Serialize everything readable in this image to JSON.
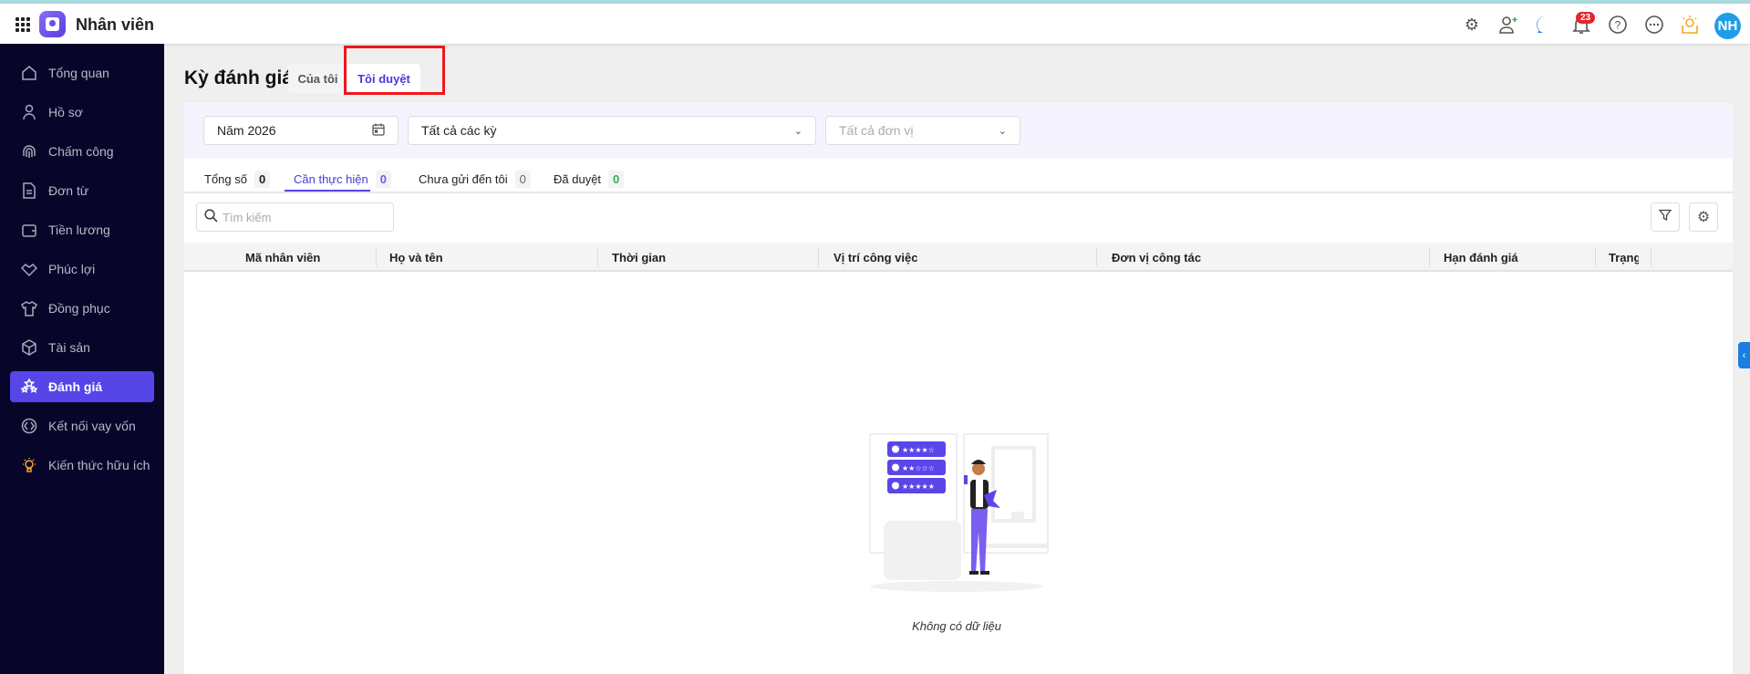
{
  "app": {
    "title": "Nhân viên",
    "notification_count": "23",
    "avatar_initials": "NH"
  },
  "topbar_icons": [
    "settings-icon",
    "add-user-icon",
    "chat-icon",
    "bell-icon",
    "help-icon",
    "more-icon",
    "knowledge-icon"
  ],
  "sidebar": {
    "items": [
      {
        "label": "Tổng quan",
        "icon": "home-icon"
      },
      {
        "label": "Hồ sơ",
        "icon": "user-icon"
      },
      {
        "label": "Chấm công",
        "icon": "fingerprint-icon"
      },
      {
        "label": "Đơn từ",
        "icon": "document-icon"
      },
      {
        "label": "Tiền lương",
        "icon": "wallet-icon"
      },
      {
        "label": "Phúc lợi",
        "icon": "handshake-icon"
      },
      {
        "label": "Đồng phục",
        "icon": "shirt-icon"
      },
      {
        "label": "Tài sản",
        "icon": "box-icon"
      },
      {
        "label": "Đánh giá",
        "icon": "stars-icon",
        "active": true
      },
      {
        "label": "Kết nối vay vốn",
        "icon": "link-icon"
      },
      {
        "label": "Kiến thức hữu ích",
        "icon": "bulb-icon"
      }
    ]
  },
  "page": {
    "title": "Kỳ đánh giá",
    "tabs": [
      {
        "label": "Của tôi"
      },
      {
        "label": "Tôi duyệt",
        "active": true
      }
    ]
  },
  "filters": {
    "year": "Năm 2026",
    "period": "Tất cả các kỳ",
    "unit_placeholder": "Tất cả đơn vị"
  },
  "status_tabs": [
    {
      "label": "Tổng số",
      "count": "0"
    },
    {
      "label": "Cần thực hiện",
      "count": "0",
      "active": true
    },
    {
      "label": "Chưa gửi đến tôi",
      "count": "0"
    },
    {
      "label": "Đã duyệt",
      "count": "0"
    }
  ],
  "search": {
    "placeholder": "Tìm kiếm"
  },
  "table": {
    "columns": [
      "Mã nhân viên",
      "Họ và tên",
      "Thời gian",
      "Vị trí công việc",
      "Đơn vị công tác",
      "Hạn đánh giá",
      "Trạng thái"
    ]
  },
  "empty": {
    "text": "Không có dữ liệu"
  },
  "colors": {
    "accent": "#5646e8",
    "sidebar": "#07062a",
    "highlight": "#f0161a"
  }
}
